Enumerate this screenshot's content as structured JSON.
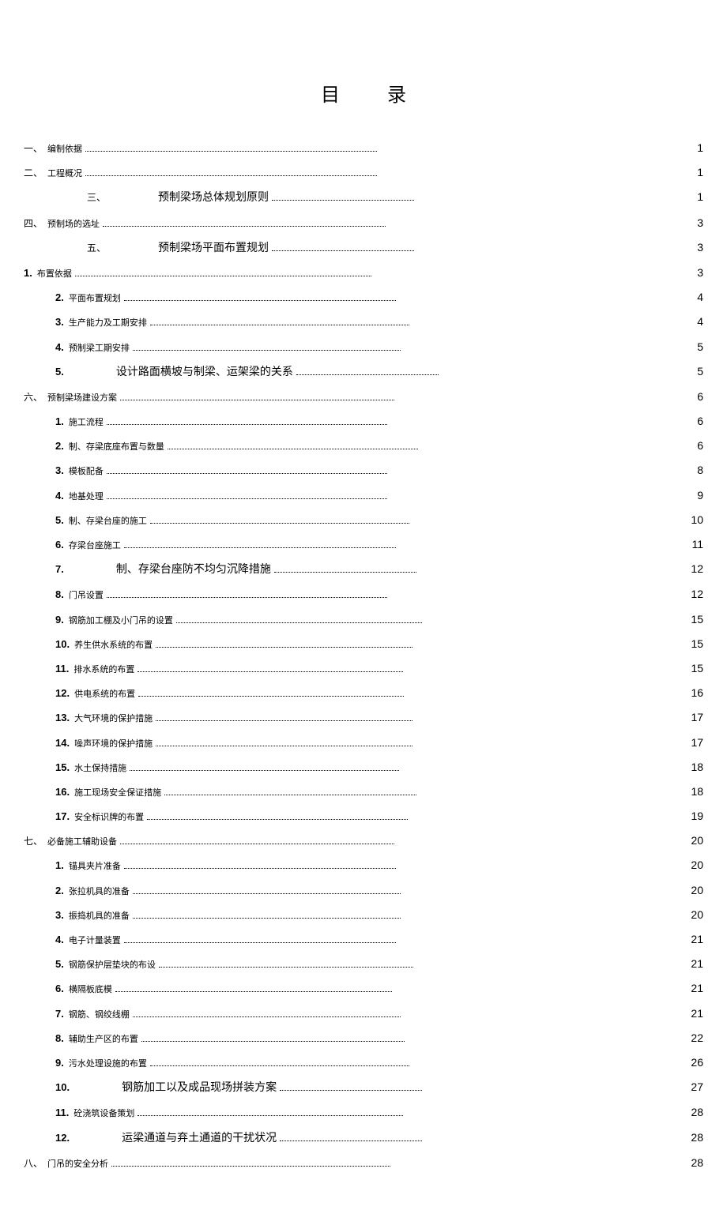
{
  "title": "目录",
  "entries": [
    {
      "level": 0,
      "num": "一、",
      "numStyle": "cn",
      "label": "编制依据",
      "labelStyle": "",
      "page": "1",
      "leader": "long"
    },
    {
      "level": 0,
      "num": "二、",
      "numStyle": "cn",
      "label": "工程概况",
      "labelStyle": "",
      "page": "1",
      "leader": "long"
    },
    {
      "level": 2,
      "num": "三、",
      "numStyle": "cn",
      "label": "预制梁场总体规划原则",
      "labelStyle": "big",
      "page": "1",
      "leader": "short",
      "centered": true
    },
    {
      "level": 0,
      "num": "四、",
      "numStyle": "cn",
      "label": "预制场的选址",
      "labelStyle": "",
      "page": "3",
      "leader": "long"
    },
    {
      "level": 2,
      "num": "五、",
      "numStyle": "cn",
      "label": "预制梁场平面布置规划",
      "labelStyle": "big",
      "page": "3",
      "leader": "short",
      "centered": true
    },
    {
      "level": 0,
      "num": "1.",
      "numStyle": "",
      "label": "布置依据",
      "labelStyle": "",
      "page": "3",
      "leader": "long"
    },
    {
      "level": 1,
      "num": "2.",
      "numStyle": "",
      "label": "平面布置规划",
      "labelStyle": "",
      "page": "4",
      "leader": "long"
    },
    {
      "level": 1,
      "num": "3.",
      "numStyle": "",
      "label": "生产能力及工期安排",
      "labelStyle": "",
      "page": "4",
      "leader": "long"
    },
    {
      "level": 1,
      "num": "4.",
      "numStyle": "",
      "label": "预制梁工期安排",
      "labelStyle": "",
      "page": "5",
      "leader": "long"
    },
    {
      "level": 1,
      "num": "5.",
      "numStyle": "",
      "label": "设计路面横坡与制梁、运架梁的关系",
      "labelStyle": "big",
      "page": "5",
      "leader": "short",
      "centered": true
    },
    {
      "level": 0,
      "num": "六、",
      "numStyle": "cn",
      "label": "预制梁场建设方案",
      "labelStyle": "",
      "page": "6",
      "leader": "long"
    },
    {
      "level": 1,
      "num": "1.",
      "numStyle": "",
      "label": "施工流程",
      "labelStyle": "",
      "page": "6",
      "leader": "long"
    },
    {
      "level": 1,
      "num": "2.",
      "numStyle": "",
      "label": "制、存梁底座布置与数量",
      "labelStyle": "",
      "page": "6",
      "leader": "long"
    },
    {
      "level": 1,
      "num": "3.",
      "numStyle": "",
      "label": "模板配备",
      "labelStyle": "",
      "page": "8",
      "leader": "long"
    },
    {
      "level": 1,
      "num": "4.",
      "numStyle": "",
      "label": "地基处理",
      "labelStyle": "",
      "page": "9",
      "leader": "long"
    },
    {
      "level": 1,
      "num": "5.",
      "numStyle": "",
      "label": "制、存梁台座的施工",
      "labelStyle": "",
      "page": "10",
      "leader": "long"
    },
    {
      "level": 1,
      "num": "6.",
      "numStyle": "",
      "label": "存梁台座施工",
      "labelStyle": "",
      "page": "11",
      "leader": "long"
    },
    {
      "level": 1,
      "num": "7.",
      "numStyle": "",
      "label": "制、存梁台座防不均匀沉降措施",
      "labelStyle": "big",
      "page": "12",
      "leader": "short",
      "centered": true
    },
    {
      "level": 1,
      "num": "8.",
      "numStyle": "",
      "label": "门吊设置",
      "labelStyle": "",
      "page": "12",
      "leader": "long"
    },
    {
      "level": 1,
      "num": "9.",
      "numStyle": "",
      "label": "钢筋加工棚及小门吊的设置",
      "labelStyle": "",
      "page": "15",
      "leader": "long"
    },
    {
      "level": 1,
      "num": "10.",
      "numStyle": "",
      "label": "养生供水系统的布置",
      "labelStyle": "",
      "page": "15",
      "leader": "long"
    },
    {
      "level": 1,
      "num": "11.",
      "numStyle": "",
      "label": "排水系统的布置",
      "labelStyle": "",
      "page": "15",
      "leader": "long"
    },
    {
      "level": 1,
      "num": "12.",
      "numStyle": "",
      "label": "供电系统的布置",
      "labelStyle": "",
      "page": "16",
      "leader": "long"
    },
    {
      "level": 1,
      "num": "13.",
      "numStyle": "",
      "label": "大气环境的保护措施",
      "labelStyle": "",
      "page": "17",
      "leader": "long"
    },
    {
      "level": 1,
      "num": "14.",
      "numStyle": "",
      "label": "噪声环境的保护措施",
      "labelStyle": "",
      "page": "17",
      "leader": "long"
    },
    {
      "level": 1,
      "num": "15.",
      "numStyle": "",
      "label": "水土保持措施",
      "labelStyle": "",
      "page": "18",
      "leader": "long"
    },
    {
      "level": 1,
      "num": "16.",
      "numStyle": "",
      "label": "施工现场安全保证措施",
      "labelStyle": "",
      "page": "18",
      "leader": "long"
    },
    {
      "level": 1,
      "num": "17.",
      "numStyle": "",
      "label": "安全标识牌的布置",
      "labelStyle": "",
      "page": "19",
      "leader": "long"
    },
    {
      "level": 0,
      "num": "七、",
      "numStyle": "cn",
      "label": "必备施工辅助设备",
      "labelStyle": "",
      "page": "20",
      "leader": "long"
    },
    {
      "level": 1,
      "num": "1.",
      "numStyle": "",
      "label": "锚具夹片准备",
      "labelStyle": "",
      "page": "20",
      "leader": "long"
    },
    {
      "level": 1,
      "num": "2.",
      "numStyle": "",
      "label": "张拉机具的准备",
      "labelStyle": "",
      "page": "20",
      "leader": "long"
    },
    {
      "level": 1,
      "num": "3.",
      "numStyle": "",
      "label": "振捣机具的准备",
      "labelStyle": "",
      "page": "20",
      "leader": "long"
    },
    {
      "level": 1,
      "num": "4.",
      "numStyle": "",
      "label": "电子计量装置",
      "labelStyle": "",
      "page": "21",
      "leader": "long"
    },
    {
      "level": 1,
      "num": "5.",
      "numStyle": "",
      "label": "钢筋保护层垫块的布设",
      "labelStyle": "",
      "page": "21",
      "leader": "long"
    },
    {
      "level": 1,
      "num": "6.",
      "numStyle": "",
      "label": "横隔板底模",
      "labelStyle": "",
      "page": "21",
      "leader": "long"
    },
    {
      "level": 1,
      "num": "7.",
      "numStyle": "",
      "label": "钢筋、钢绞线棚",
      "labelStyle": "",
      "page": "21",
      "leader": "long"
    },
    {
      "level": 1,
      "num": "8.",
      "numStyle": "",
      "label": "辅助生产区的布置",
      "labelStyle": "",
      "page": "22",
      "leader": "long"
    },
    {
      "level": 1,
      "num": "9.",
      "numStyle": "",
      "label": "污水处理设施的布置",
      "labelStyle": "",
      "page": "26",
      "leader": "long"
    },
    {
      "level": 1,
      "num": "10.",
      "numStyle": "",
      "label": "钢筋加工以及成品现场拼装方案",
      "labelStyle": "big",
      "page": "27",
      "leader": "short",
      "centered": true
    },
    {
      "level": 1,
      "num": "11.",
      "numStyle": "",
      "label": "砼浇筑设备策划",
      "labelStyle": "",
      "page": "28",
      "leader": "long"
    },
    {
      "level": 1,
      "num": "12.",
      "numStyle": "",
      "label": "运梁通道与弃土通道的干扰状况",
      "labelStyle": "big",
      "page": "28",
      "leader": "short",
      "centered": true
    },
    {
      "level": 0,
      "num": "八、",
      "numStyle": "cn",
      "label": "门吊的安全分析",
      "labelStyle": "",
      "page": "28",
      "leader": "long"
    }
  ]
}
